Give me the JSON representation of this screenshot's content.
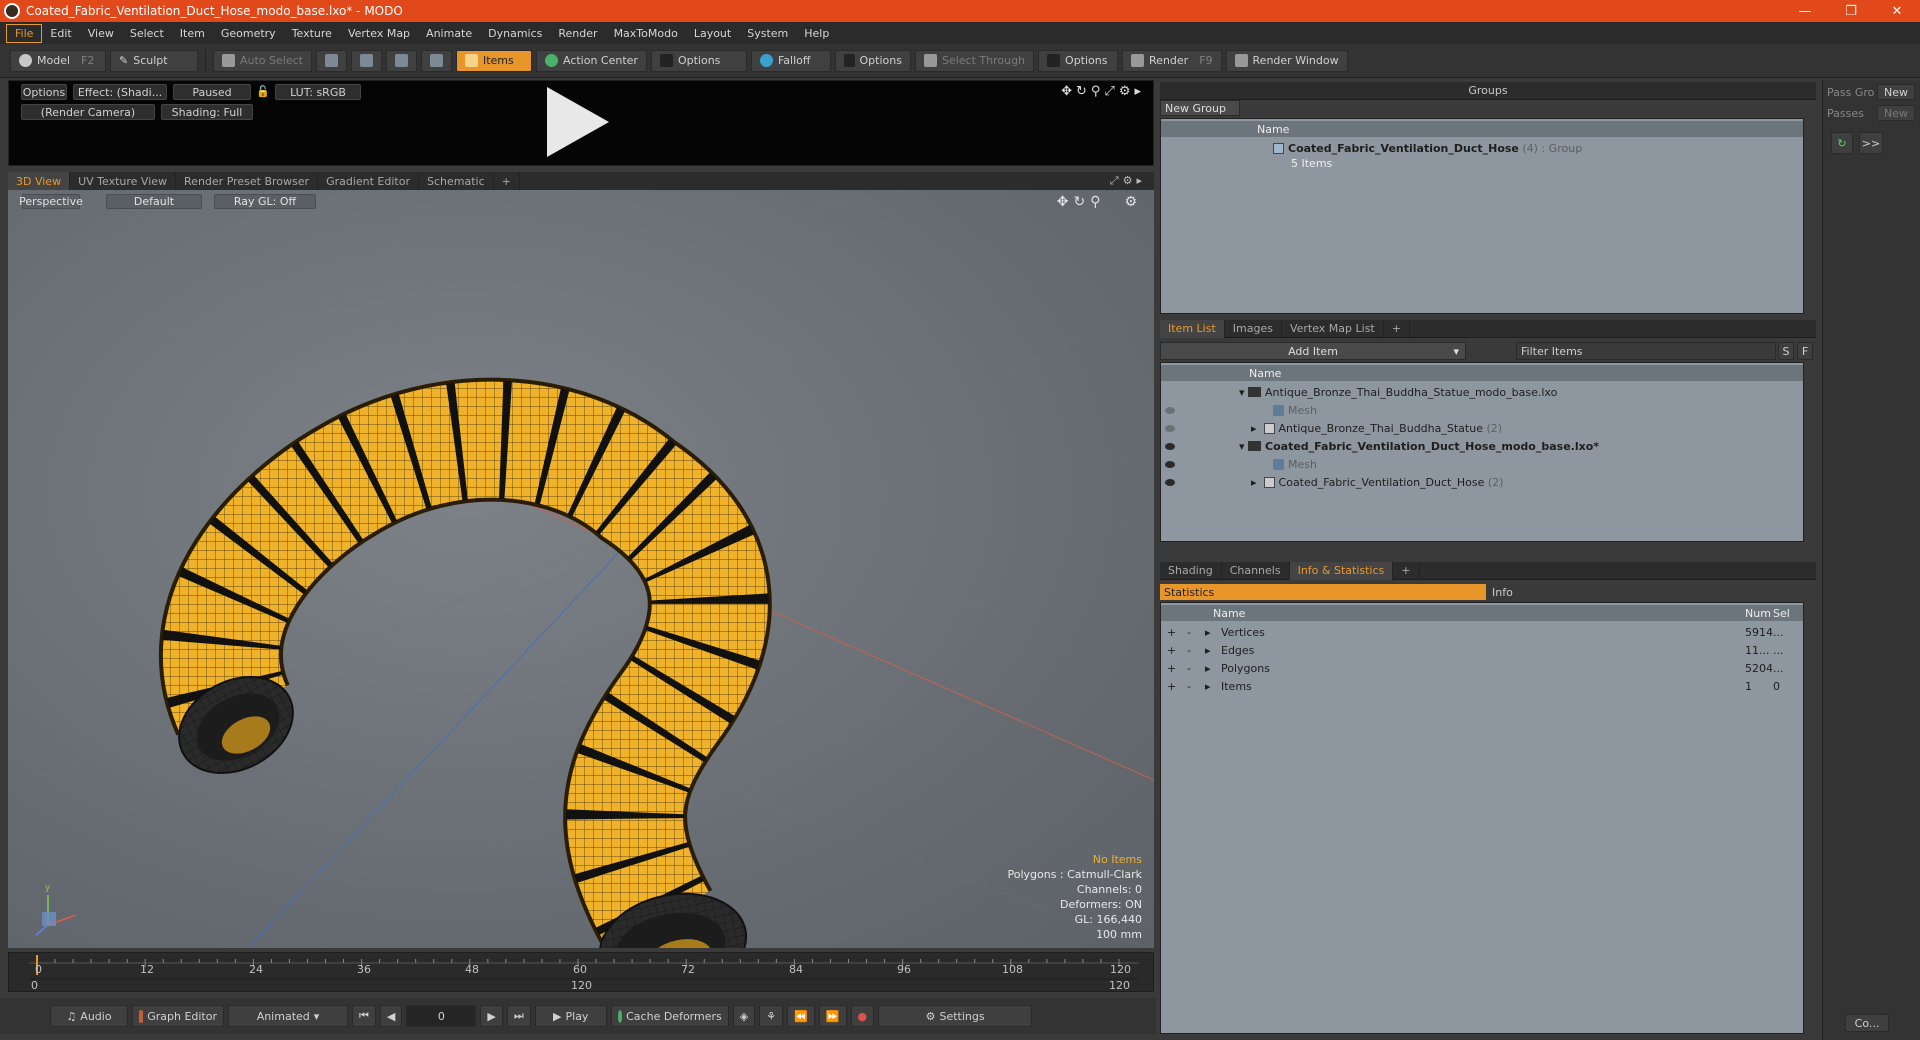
{
  "window": {
    "title": "Coated_Fabric_Ventilation_Duct_Hose_modo_base.lxo* - MODO",
    "controls": [
      "—",
      "❐",
      "✕"
    ]
  },
  "menu": [
    "File",
    "Edit",
    "View",
    "Select",
    "Item",
    "Geometry",
    "Texture",
    "Vertex Map",
    "Animate",
    "Dynamics",
    "Render",
    "MaxToModo",
    "Layout",
    "System",
    "Help"
  ],
  "toolbar": {
    "model": "Model",
    "model_key": "F2",
    "sculpt": "Sculpt",
    "auto_select": "Auto Select",
    "items": "Items",
    "action_center": "Action Center",
    "options1": "Options",
    "falloff": "Falloff",
    "options2": "Options",
    "select_through": "Select Through",
    "options3": "Options",
    "render": "Render",
    "render_key": "F9",
    "render_window": "Render Window"
  },
  "preview": {
    "options": "Options",
    "effect": "Effect: (Shadi...",
    "paused": "Paused",
    "lut": "LUT: sRGB",
    "camera": "(Render Camera)",
    "shading": "Shading: Full"
  },
  "viewport_tabs": [
    "3D View",
    "UV Texture View",
    "Render Preset Browser",
    "Gradient Editor",
    "Schematic",
    "+"
  ],
  "viewport": {
    "perspective": "Perspective",
    "default": "Default",
    "raygl": "Ray GL: Off",
    "info": {
      "selection": "No Items",
      "polygons": "Polygons : Catmull-Clark",
      "channels": "Channels: 0",
      "deformers": "Deformers: ON",
      "gl": "GL: 166,440",
      "scale": "100 mm"
    }
  },
  "timeline": {
    "ticks": [
      "0",
      "12",
      "24",
      "36",
      "48",
      "60",
      "72",
      "84",
      "96",
      "108",
      "120"
    ],
    "range_start": "0",
    "range_mid": "120",
    "range_end": "120"
  },
  "transport": {
    "audio": "Audio",
    "graph_editor": "Graph Editor",
    "animated": "Animated",
    "frame": "0",
    "play": "Play",
    "cache_deformers": "Cache Deformers",
    "settings": "Settings"
  },
  "groups": {
    "title": "Groups",
    "new_group": "New Group",
    "col_name": "Name",
    "group_name": "Coated_Fabric_Ventilation_Duct_Hose",
    "group_count": "(4)",
    "group_type": ": Group",
    "group_items": "5 Items"
  },
  "far_right": {
    "pass_gro": "Pass Gro",
    "new1": "New",
    "passes": "Passes",
    "new2": "New",
    "more": ">>",
    "co": "Co..."
  },
  "item_list": {
    "tabs": [
      "Item List",
      "Images",
      "Vertex Map List",
      "+"
    ],
    "add_item": "Add Item",
    "filter": "Filter Items",
    "s": "S",
    "f": "F",
    "col_name": "Name",
    "rows": [
      {
        "label": "Antique_Bronze_Thai_Buddha_Statue_modo_base.lxo",
        "count": "",
        "kind": "scene"
      },
      {
        "label": "Mesh",
        "count": "",
        "kind": "mesh"
      },
      {
        "label": "Antique_Bronze_Thai_Buddha_Statue",
        "count": "(2)",
        "kind": "item"
      },
      {
        "label": "Coated_Fabric_Ventilation_Duct_Hose_modo_base.lxo*",
        "count": "",
        "kind": "scene-bold"
      },
      {
        "label": "Mesh",
        "count": "",
        "kind": "mesh"
      },
      {
        "label": "Coated_Fabric_Ventilation_Duct_Hose",
        "count": "(2)",
        "kind": "item"
      }
    ]
  },
  "stats": {
    "tabs": [
      "Shading",
      "Channels",
      "Info & Statistics",
      "+"
    ],
    "statistics": "Statistics",
    "info": "Info",
    "col_name": "Name",
    "col_num": "Num",
    "col_sel": "Sel",
    "rows": [
      {
        "name": "Vertices",
        "num": "5914",
        "sel": "..."
      },
      {
        "name": "Edges",
        "num": "11...",
        "sel": "..."
      },
      {
        "name": "Polygons",
        "num": "5204",
        "sel": "..."
      },
      {
        "name": "Items",
        "num": "1",
        "sel": "0"
      }
    ]
  }
}
